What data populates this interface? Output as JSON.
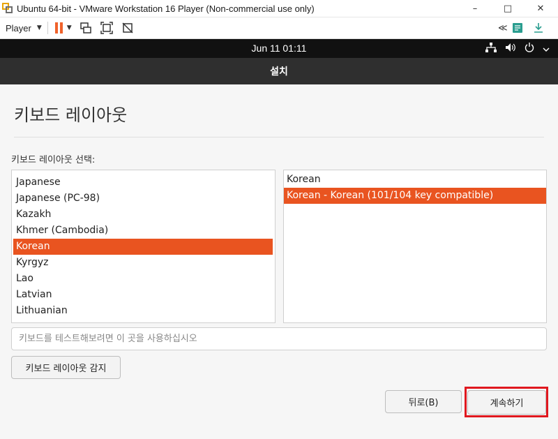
{
  "window": {
    "title": "Ubuntu 64-bit - VMware Workstation 16 Player (Non-commercial use only)",
    "minimize": "–",
    "maximize": "□",
    "close": "✕"
  },
  "toolbar": {
    "player_label": "Player",
    "dropdown": "▼",
    "collapse": "≪"
  },
  "topbar": {
    "datetime": "Jun 11  01:11"
  },
  "installer": {
    "header_title": "설치",
    "page_title": "키보드 레이아웃",
    "section_label": "키보드 레이아웃 선택:",
    "layouts": [
      "Japanese",
      "Japanese (PC-98)",
      "Kazakh",
      "Khmer (Cambodia)",
      "Korean",
      "Kyrgyz",
      "Lao",
      "Latvian",
      "Lithuanian"
    ],
    "selected_layout": "Korean",
    "variants": [
      "Korean",
      "Korean - Korean (101/104 key compatible)"
    ],
    "selected_variant": "Korean - Korean (101/104 key compatible)",
    "test_placeholder": "키보드를 테스트해보려면 이 곳을 사용하십시오",
    "detect_button": "키보드 레이아웃 감지",
    "back_button": "뒤로(B)",
    "continue_button": "계속하기"
  },
  "colors": {
    "accent": "#e95420",
    "header": "#2f2f2f",
    "highlight": "#e0181f"
  }
}
